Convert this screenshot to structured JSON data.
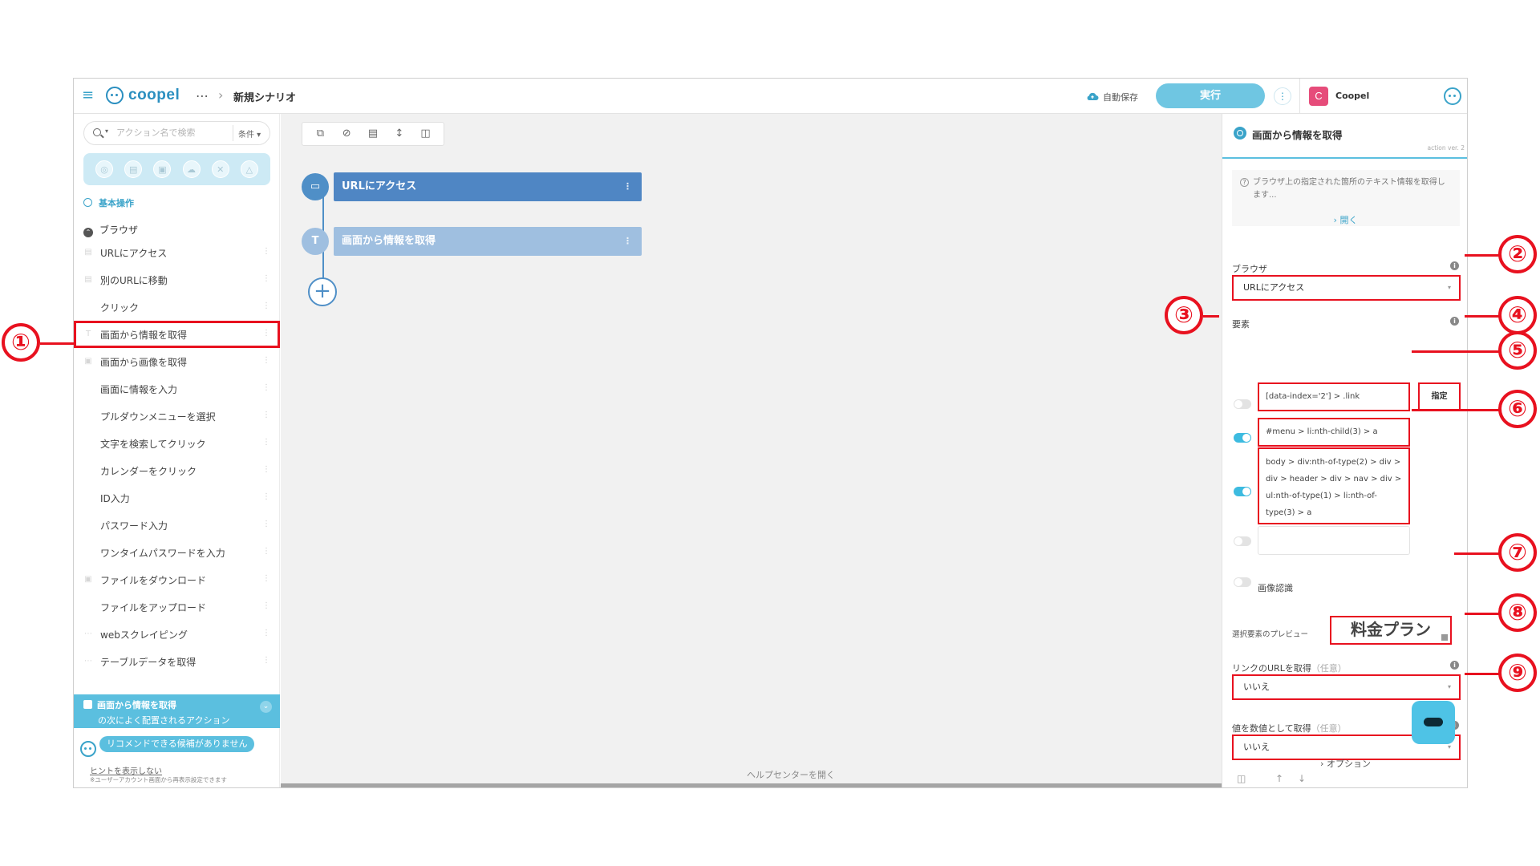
{
  "header": {
    "logo": "coopel",
    "more": "⋯",
    "breadcrumb_sep": "›",
    "scenario_name": "新規シナリオ",
    "autosave": "自動保存",
    "run_label": "実行",
    "kebab": "⋮",
    "workspace_initial": "C",
    "workspace_name": "Coopel"
  },
  "sidebar": {
    "search_placeholder": "アクション名で検索",
    "search_filter": "条件 ▾",
    "category_icons": [
      "globe-icon",
      "window-icon",
      "document-icon",
      "cloud-icon",
      "tools-icon",
      "network-icon"
    ],
    "section": "基本操作",
    "group": "ブラウザ",
    "actions": [
      {
        "label": "URLにアクセス",
        "icon": "window-icon"
      },
      {
        "label": "別のURLに移動",
        "icon": "window-icon"
      },
      {
        "label": "クリック",
        "icon": ""
      },
      {
        "label": "画面から情報を取得",
        "icon": "text-icon"
      },
      {
        "label": "画面から画像を取得",
        "icon": "image-icon"
      },
      {
        "label": "画面に情報を入力",
        "icon": ""
      },
      {
        "label": "プルダウンメニューを選択",
        "icon": ""
      },
      {
        "label": "文字を検索してクリック",
        "icon": ""
      },
      {
        "label": "カレンダーをクリック",
        "icon": ""
      },
      {
        "label": "ID入力",
        "icon": ""
      },
      {
        "label": "パスワード入力",
        "icon": ""
      },
      {
        "label": "ワンタイムパスワードを入力",
        "icon": ""
      },
      {
        "label": "ファイルをダウンロード",
        "icon": "document-icon"
      },
      {
        "label": "ファイルをアップロード",
        "icon": ""
      },
      {
        "label": "webスクレイピング",
        "icon": "table-icon"
      },
      {
        "label": "テーブルデータを取得",
        "icon": "table-icon"
      }
    ],
    "recommend_title": "画面から情報を取得",
    "recommend_sub": "の次によく配置されるアクション",
    "recommend_empty": "リコメンドできる候補がありません",
    "hint_hide": "ヒントを表示しない",
    "hint_note": "※ユーザーアカウント画面から再表示設定できます"
  },
  "canvas": {
    "toolbar_icons": [
      "copy-icon",
      "hide-icon",
      "comment-icon",
      "split-icon",
      "delete-icon"
    ],
    "nodes": [
      {
        "label": "URLにアクセス",
        "icon": "▭",
        "color": "#4f8fc7",
        "card_color": "#4f86c4"
      },
      {
        "label": "画面から情報を取得",
        "icon": "T",
        "color": "#9fbfe0",
        "card_color": "#9fbfe0"
      }
    ],
    "add": "+",
    "help_center": "ヘルプセンターを開く"
  },
  "panel": {
    "title": "画面から情報を取得",
    "version": "action ver. 2",
    "description": "ブラウザ上の指定された箇所のテキスト情報を取得します...",
    "open": "› 開く",
    "browser_label": "ブラウザ",
    "browser_value": "URLにアクセス",
    "element_label": "要素",
    "selectors": [
      {
        "value": "[data-index='2'] > .link",
        "enabled": false
      },
      {
        "value": "#menu > li:nth-child(3) > a",
        "enabled": true
      },
      {
        "value": "body > div:nth-of-type(2) > div > div > header > div > nav > div > ul:nth-of-type(1) > li:nth-of-type(3) > a",
        "enabled": true
      },
      {
        "value": "",
        "enabled": false
      }
    ],
    "specify_label": "指定",
    "image_recognition": "画像認識",
    "preview_label": "選択要素のプレビュー",
    "preview_value": "料金プラン",
    "link_url_label": "リンクのURLを取得",
    "optional": "（任意）",
    "link_url_value": "いいえ",
    "numeric_label": "値を数値として取得",
    "numeric_value": "いいえ",
    "options": "› オプション",
    "footer_icons": [
      "trash-icon",
      "arrow-up-icon",
      "arrow-down-icon"
    ]
  },
  "callouts": [
    "①",
    "②",
    "③",
    "④",
    "⑤",
    "⑥",
    "⑦",
    "⑧",
    "⑨"
  ],
  "colors": {
    "accent": "#3aa3c9",
    "run": "#6fc6e2",
    "highlight": "#e8111f",
    "node_primary": "#4f86c4",
    "node_secondary": "#9fbfe0"
  }
}
